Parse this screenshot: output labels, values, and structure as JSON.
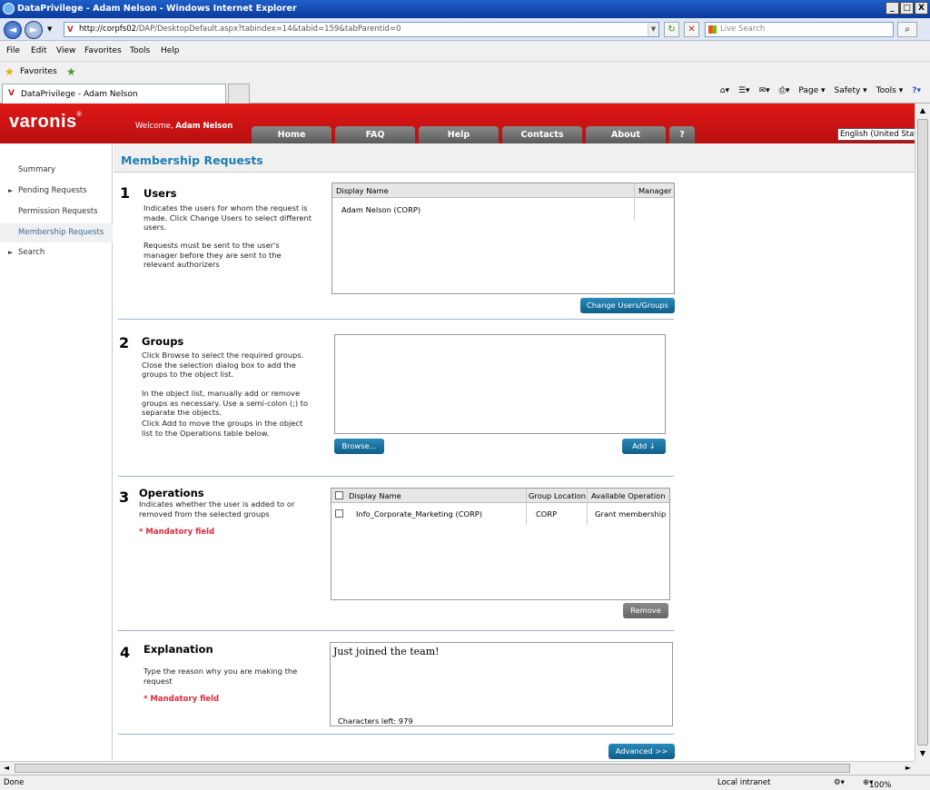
{
  "window": {
    "title": "DataPrivilege - Adam Nelson - Windows Internet Explorer",
    "controls": [
      "_",
      "□",
      "X"
    ]
  },
  "browser": {
    "address_host": "http://corpfs02",
    "address_path": "/DAP/DesktopDefault.aspx?tabindex=14&tabid=159&tabParentid=0",
    "search_placeholder": "Live Search",
    "menu": [
      "File",
      "Edit",
      "View",
      "Favorites",
      "Tools",
      "Help"
    ],
    "favorites_label": "Favorites",
    "tab_title": "DataPrivilege - Adam Nelson",
    "cmd": {
      "page": "Page ▾",
      "safety": "Safety ▾",
      "tools": "Tools ▾"
    },
    "status_left": "Done",
    "zone": "Local intranet",
    "zoom": "100%"
  },
  "app": {
    "logo": "varonis",
    "welcome_prefix": "Welcome,",
    "welcome_user": "Adam Nelson",
    "nav": [
      "Home",
      "FAQ",
      "Help",
      "Contacts",
      "About",
      "?"
    ],
    "language": "English (United States)",
    "sidebar": [
      "Summary",
      "Pending Requests",
      "Permission Requests",
      "Membership Requests",
      "Search"
    ],
    "page_title": "Membership Requests"
  },
  "users": {
    "num": "1",
    "title": "Users",
    "desc1": "Indicates the users for whom the request is made. Click Change Users to select different users.",
    "desc2": "Requests must be sent to the user's manager before they are sent to the relevant authorizers",
    "col_display": "Display Name",
    "col_manager": "Manager",
    "row": "Adam Nelson (CORP)",
    "button": "Change Users/Groups"
  },
  "groups": {
    "num": "2",
    "title": "Groups",
    "desc1": "Click Browse to select the required groups. Close the selection dialog box to add the groups to the object list.",
    "desc2": "In the object list, manually add or remove groups as necessary. Use a semi-colon (;) to separate the objects.",
    "desc3": "Click Add to move the groups in the object list to the Operations table below.",
    "browse": "Browse...",
    "add": "Add"
  },
  "operations": {
    "num": "3",
    "title": "Operations",
    "desc": "Indicates whether the user is added to or removed from the selected groups",
    "mandatory": "* Mandatory field",
    "col_display": "Display Name",
    "col_location": "Group Location",
    "col_op": "Available Operation",
    "row": {
      "name": "Info_Corporate_Marketing (CORP)",
      "location": "CORP",
      "op": "Grant membership"
    },
    "remove": "Remove"
  },
  "explanation": {
    "num": "4",
    "title": "Explanation",
    "desc": "Type the reason why you are making the request",
    "mandatory": "* Mandatory field",
    "text": "Just joined the team!",
    "chars_left": "Characters left: 979",
    "advanced": "Advanced >>"
  }
}
